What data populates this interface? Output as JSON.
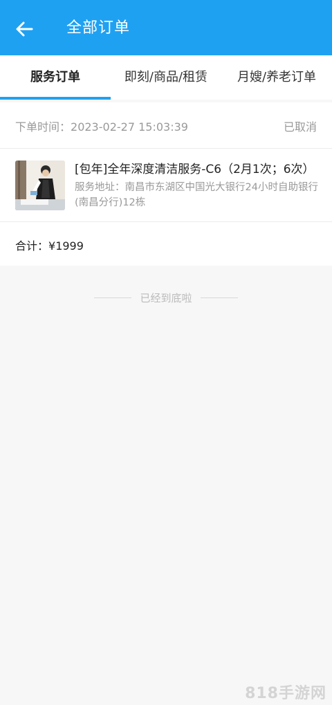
{
  "appbar": {
    "title": "全部订单",
    "back_icon": "arrow-left-icon",
    "color": "#1fa1f2"
  },
  "tabs": [
    {
      "label": "服务订单",
      "active": true
    },
    {
      "label": "即刻/商品/租赁",
      "active": false
    },
    {
      "label": "月嫂/养老订单",
      "active": false
    }
  ],
  "order": {
    "time_label": "下单时间：",
    "time_value": "2023-02-27 15:03:39",
    "status": "已取消",
    "item_title": "[包年]全年深度清洁服务-C6（2月1次；6次）",
    "address_label": "服务地址：",
    "address_value": "南昌市东湖区中国光大银行24小时自助银行(南昌分行)12栋",
    "total_label": "合计：",
    "total_value": "¥1999"
  },
  "footer": {
    "end_text": "已经到底啦"
  },
  "watermark": "818手游网"
}
